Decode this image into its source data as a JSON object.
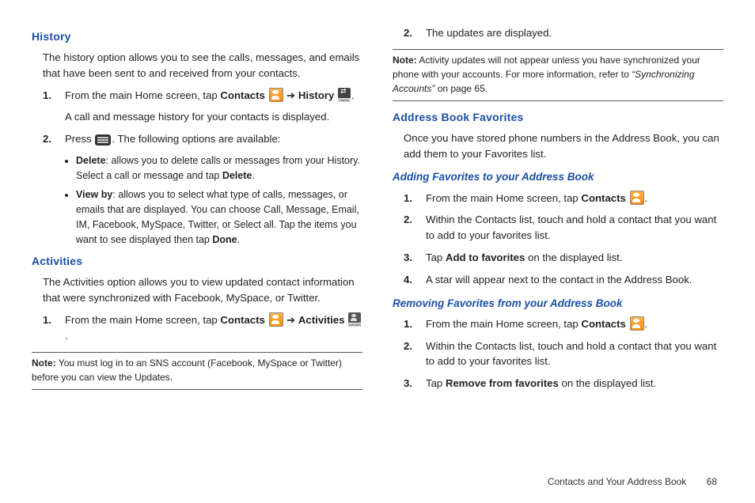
{
  "left": {
    "history": {
      "heading": "History",
      "intro": "The history option allows you to see the calls, messages, and emails that have been sent to and received from your contacts.",
      "step1_a": "From the main Home screen, tap ",
      "step1_b": "Contacts",
      "step1_c": " ➔ ",
      "step1_d": "History",
      "step1_e": ".",
      "step1_sub": "A call and message history for your contacts is displayed.",
      "step2_a": "Press ",
      "step2_b": ". The following options are available:",
      "bullet1_a": "Delete",
      "bullet1_b": ": allows you to delete calls or messages from your History. Select a call or message and tap ",
      "bullet1_c": "Delete",
      "bullet1_d": ".",
      "bullet2_a": "View by",
      "bullet2_b": ": allows you to select what type of calls, messages, or emails that are displayed. You can choose Call, Message, Email, IM, Facebook, MySpace, Twitter, or Select all. Tap the items you want to see displayed then tap ",
      "bullet2_c": "Done",
      "bullet2_d": "."
    },
    "activities": {
      "heading": "Activities",
      "intro": "The Activities option allows you to view updated contact information that were synchronized with Facebook, MySpace, or Twitter.",
      "step1_a": "From the main Home screen, tap ",
      "step1_b": "Contacts",
      "step1_c": " ➔ ",
      "step1_d": "Activities",
      "step1_e": "."
    },
    "note": {
      "label": "Note:",
      "body": " You must log in to an SNS account (Facebook, MySpace or Twitter) before you can view the Updates."
    }
  },
  "right": {
    "step2": "The updates are displayed.",
    "note": {
      "label": "Note:",
      "body_a": " Activity updates will not appear unless you have synchronized your phone with your accounts. For more information, refer to ",
      "body_b": "“Synchronizing Accounts”",
      "body_c": "  on page 65."
    },
    "favorites": {
      "heading": "Address Book Favorites",
      "intro": "Once you have stored phone numbers in the Address Book, you can add them to your Favorites list."
    },
    "adding": {
      "heading": "Adding Favorites to your Address Book",
      "s1_a": "From the main Home screen, tap ",
      "s1_b": "Contacts",
      "s1_c": ".",
      "s2": "Within the Contacts list, touch and hold a contact that you want to add to your favorites list.",
      "s3_a": "Tap ",
      "s3_b": "Add to favorites",
      "s3_c": " on the displayed list.",
      "s4": "A star will appear next to the contact in the Address Book."
    },
    "removing": {
      "heading": "Removing Favorites from your Address Book",
      "s1_a": "From the main Home screen, tap ",
      "s1_b": "Contacts",
      "s1_c": ".",
      "s2": "Within the Contacts list, touch and hold a contact that you want to add to your favorites list.",
      "s3_a": "Tap ",
      "s3_b": "Remove from favorites",
      "s3_c": " on the displayed list."
    }
  },
  "footer": {
    "title": "Contacts and Your Address Book",
    "page": "68"
  },
  "icons": {
    "history_caption": "History",
    "activities_caption": "Activities"
  }
}
